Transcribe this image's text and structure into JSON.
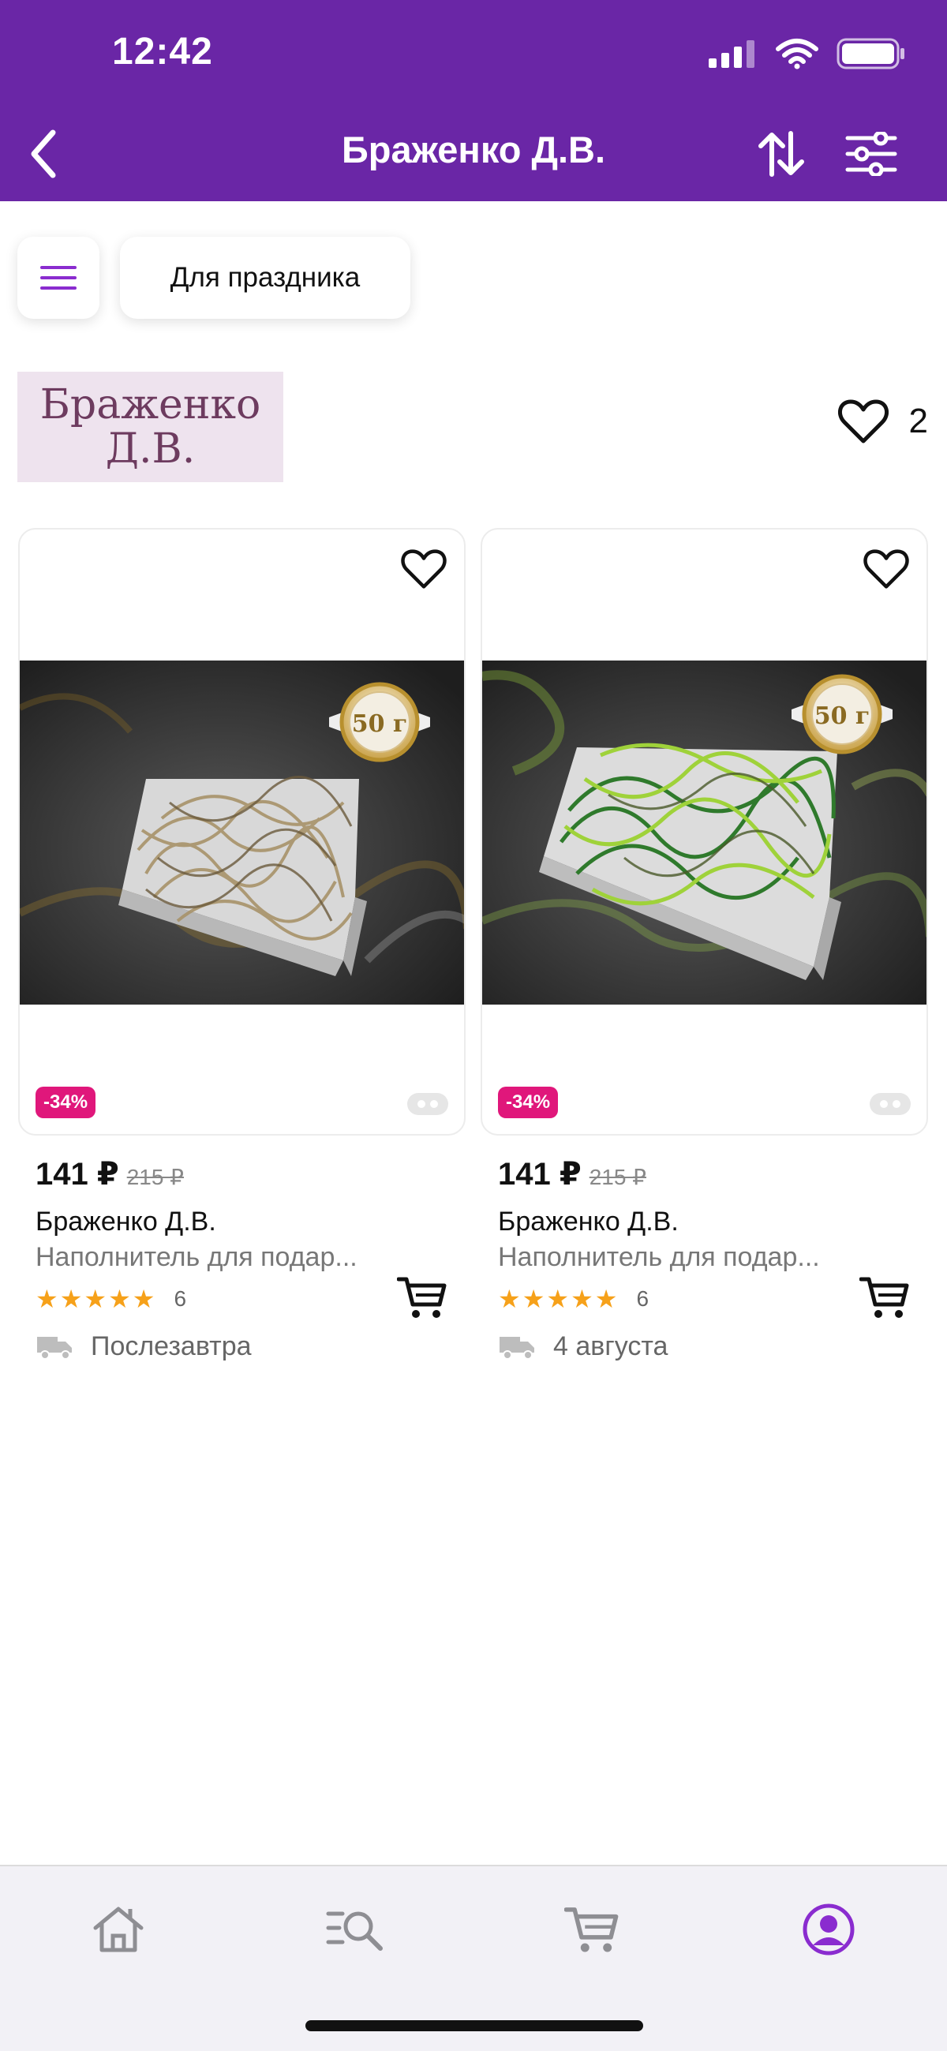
{
  "status_bar": {
    "time": "12:42"
  },
  "nav": {
    "title": "Браженко Д.В.",
    "back_icon": "chevron-left-icon",
    "sort_icon": "sort-arrows-icon",
    "filter_icon": "sliders-icon"
  },
  "chips": {
    "menu_icon": "hamburger-icon",
    "filter_label": "Для праздника"
  },
  "seller": {
    "logo_line1": "Браженко",
    "logo_line2": "Д.В.",
    "favorites_count": "2"
  },
  "products": [
    {
      "badge_weight": "50 г",
      "discount": "-34%",
      "price": "141 ₽",
      "old_price": "215 ₽",
      "brand": "Браженко Д.В.",
      "name": "Наполнитель для подар...",
      "rating_stars": "★★★★★",
      "rating": 5,
      "reviews": "6",
      "delivery": "Послезавтра"
    },
    {
      "badge_weight": "50 г",
      "discount": "-34%",
      "price": "141 ₽",
      "old_price": "215 ₽",
      "brand": "Браженко Д.В.",
      "name": "Наполнитель для подар...",
      "rating_stars": "★★★★★",
      "rating": 5,
      "reviews": "6",
      "delivery": "4 августа"
    }
  ],
  "tabbar": {
    "items": [
      "home-icon",
      "catalog-search-icon",
      "cart-icon",
      "profile-icon"
    ],
    "active": "profile-icon"
  },
  "colors": {
    "header_bg": "#6a26a6",
    "accent": "#8a2ccf",
    "discount_badge": "#e0177b",
    "star": "#f6a11a"
  }
}
